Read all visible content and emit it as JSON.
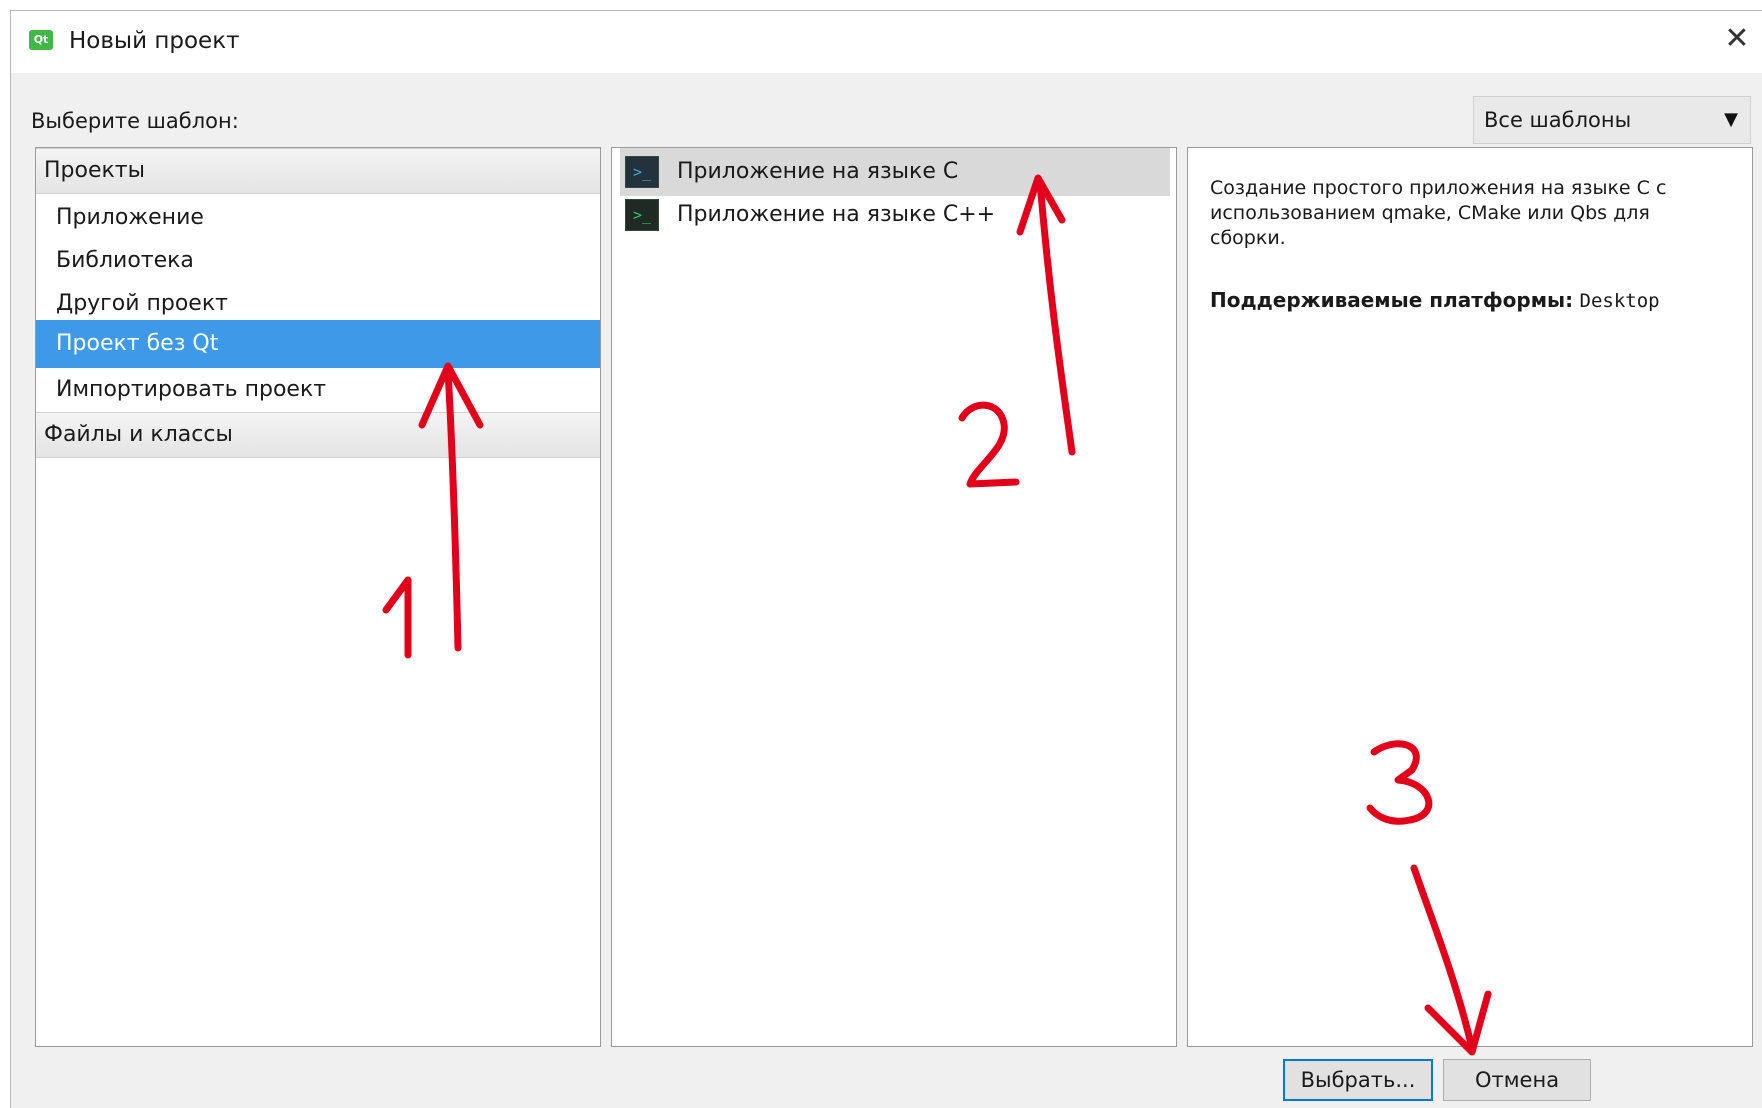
{
  "window": {
    "title": "Новый проект",
    "app_icon": "qt-logo-icon",
    "app_icon_text": "Qt",
    "close_glyph": "✕"
  },
  "template_label": "Выберите шаблон:",
  "filter": {
    "selected": "Все шаблоны",
    "arrow_glyph": "▼"
  },
  "categories": {
    "groups": [
      {
        "label": "Проекты",
        "items": [
          {
            "label": "Приложение",
            "selected": false
          },
          {
            "label": "Библиотека",
            "selected": false
          },
          {
            "label": "Другой проект",
            "selected": false
          },
          {
            "label": "Проект без Qt",
            "selected": true
          },
          {
            "label": "Импортировать проект",
            "selected": false
          }
        ]
      },
      {
        "label": "Файлы и классы",
        "items": []
      }
    ]
  },
  "templates": [
    {
      "label": "Приложение на языке C",
      "icon": "terminal-icon",
      "icon_text": ">_",
      "selected": true
    },
    {
      "label": "Приложение на языке C++",
      "icon": "terminal-icon",
      "icon_text": ">_",
      "selected": false
    }
  ],
  "details": {
    "description": "Создание простого приложения на языке C с использованием qmake, CMake или Qbs для сборки.",
    "platforms_label": "Поддерживаемые платформы:",
    "platforms_value": "Desktop"
  },
  "buttons": {
    "choose": "Выбрать...",
    "cancel": "Отмена"
  },
  "annotations": {
    "color": "#e3001b",
    "labels": [
      "1",
      "2",
      "3"
    ]
  },
  "colors": {
    "selection": "#3e9ae8",
    "focus_border": "#0078d7"
  }
}
